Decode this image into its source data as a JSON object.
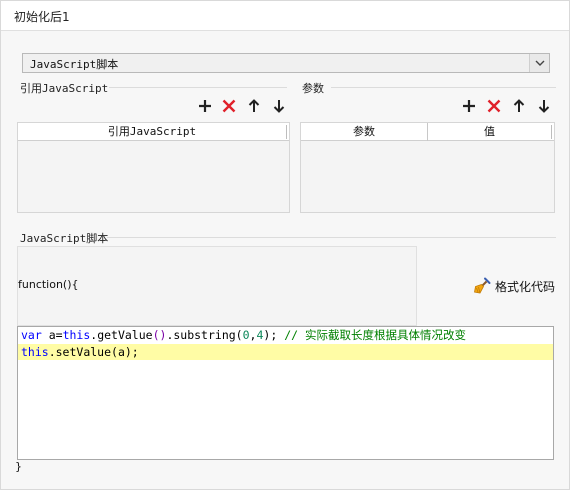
{
  "title": "初始化后1",
  "script_type": {
    "selected": "JavaScript脚本"
  },
  "references": {
    "label": "引用JavaScript",
    "columns": [
      "引用JavaScript"
    ]
  },
  "params": {
    "label": "参数",
    "columns": [
      "参数",
      "值"
    ]
  },
  "script": {
    "label": "JavaScript脚本",
    "signature": "function(){",
    "closing": "}",
    "format_label": "格式化代码",
    "lines": [
      {
        "kw1": "var",
        "t1": " a=",
        "kw2": "this",
        "t2": ".getValue",
        "p1": "()",
        "t3": ".substring(",
        "n1": "0",
        "t4": ",",
        "n2": "4",
        "t5": "); ",
        "comment": "// 实际截取长度根据具体情况改变"
      },
      {
        "kw1": "this",
        "t1": ".setValue(a);"
      }
    ]
  },
  "icon_colors": {
    "add": "#222222",
    "delete": "#e0202a",
    "arrow": "#222222"
  }
}
